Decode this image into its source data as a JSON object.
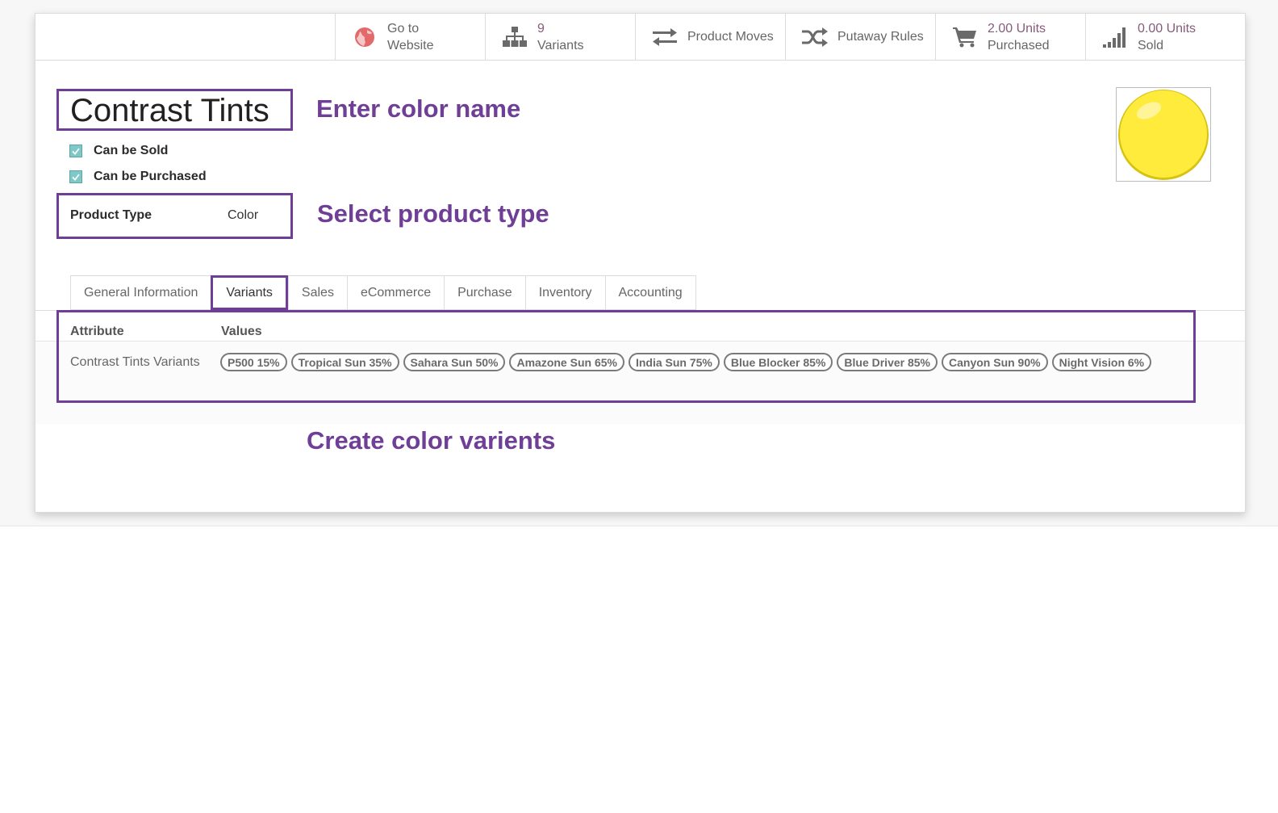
{
  "smart_buttons": {
    "website": {
      "line1": "Go to",
      "line2": "Website",
      "icon": "globe-icon"
    },
    "variants": {
      "value": "9",
      "label": "Variants",
      "icon": "sitemap-icon"
    },
    "moves": {
      "label": "Product Moves",
      "icon": "exchange-arrows-icon"
    },
    "putaway": {
      "label": "Putaway Rules",
      "icon": "shuffle-icon"
    },
    "purchased": {
      "value": "2.00 Units",
      "label": "Purchased",
      "icon": "cart-icon"
    },
    "sold": {
      "value": "0.00 Units",
      "label": "Sold",
      "icon": "signal-bars-icon"
    }
  },
  "product": {
    "name": "Contrast Tints",
    "can_be_sold_label": "Can be Sold",
    "can_be_sold": true,
    "can_be_purchased_label": "Can be Purchased",
    "can_be_purchased": true,
    "type_label": "Product Type",
    "type_value": "Color",
    "image_color": "#ffeb3b"
  },
  "annotations": {
    "name_hint": "Enter color name",
    "type_hint": "Select product type",
    "variants_hint": "Create color varients"
  },
  "tabs": [
    {
      "label": "General Information",
      "active": false
    },
    {
      "label": "Variants",
      "active": true
    },
    {
      "label": "Sales",
      "active": false
    },
    {
      "label": "eCommerce",
      "active": false
    },
    {
      "label": "Purchase",
      "active": false
    },
    {
      "label": "Inventory",
      "active": false
    },
    {
      "label": "Accounting",
      "active": false
    }
  ],
  "variants_table": {
    "headers": [
      "Attribute",
      "Values"
    ],
    "rows": [
      {
        "attribute": "Contrast Tints Variants",
        "values": [
          "P500 15%",
          "Tropical Sun 35%",
          "Sahara Sun 50%",
          "Amazone Sun 65%",
          "India Sun 75%",
          "Blue Blocker 85%",
          "Blue Driver 85%",
          "Canyon Sun 90%",
          "Night Vision 6%"
        ]
      }
    ]
  },
  "colors": {
    "accent": "#6f3f97",
    "odoo_purple": "#875a7b"
  }
}
